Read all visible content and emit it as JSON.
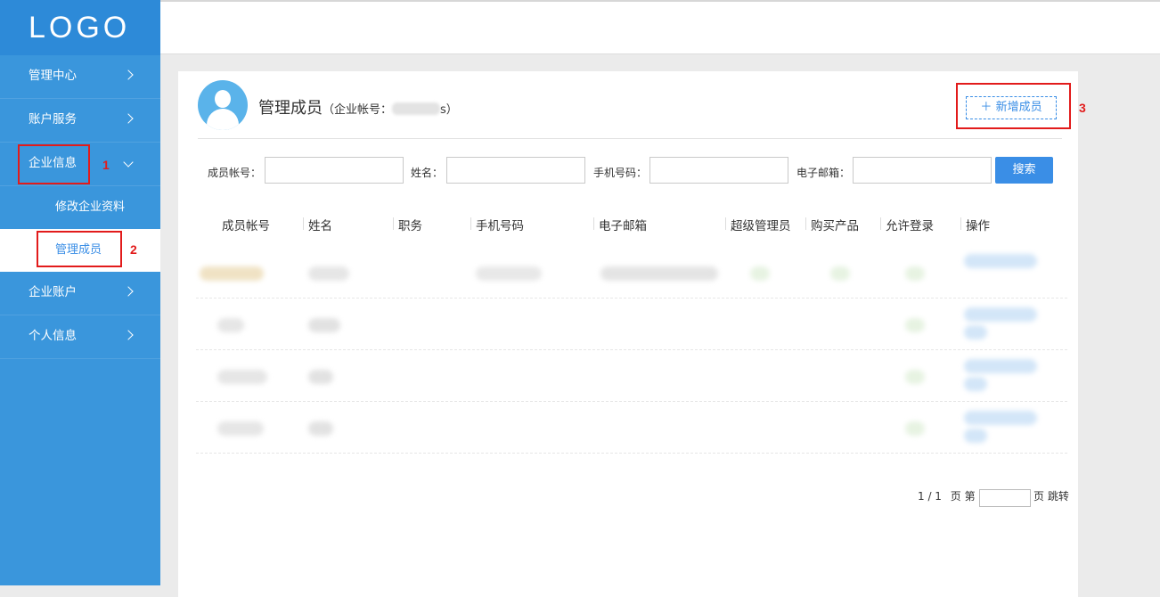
{
  "logo": "LOGO",
  "sidebar": {
    "items": [
      {
        "label": "管理中心"
      },
      {
        "label": "账户服务"
      },
      {
        "label": "企业信息",
        "expanded": true,
        "children": [
          {
            "label": "修改企业资料"
          },
          {
            "label": "管理成员",
            "active": true
          }
        ]
      },
      {
        "label": "企业账户"
      },
      {
        "label": "个人信息"
      }
    ]
  },
  "header": {
    "title": "管理成员",
    "account_prefix": "（企业帐号：",
    "account_suffix": "s）"
  },
  "actions": {
    "add_member": "新增成员",
    "add_icon": "plus-icon"
  },
  "annotations": [
    "1",
    "2",
    "3"
  ],
  "filters": {
    "member_account": "成员帐号：",
    "name": "姓名：",
    "phone": "手机号码：",
    "email": "电子邮箱：",
    "search": "搜索"
  },
  "table": {
    "columns": [
      "成员帐号",
      "姓名",
      "职务",
      "手机号码",
      "电子邮箱",
      "超级管理员",
      "购买产品",
      "允许登录",
      "操作"
    ]
  },
  "pager": {
    "page_info": "1 / 1",
    "go_label": "页 第",
    "jump_label": "页 跳转"
  },
  "colors": {
    "sidebar": "#3a96dc",
    "accent": "#3a8ee6",
    "annotation": "#e21b1b"
  }
}
